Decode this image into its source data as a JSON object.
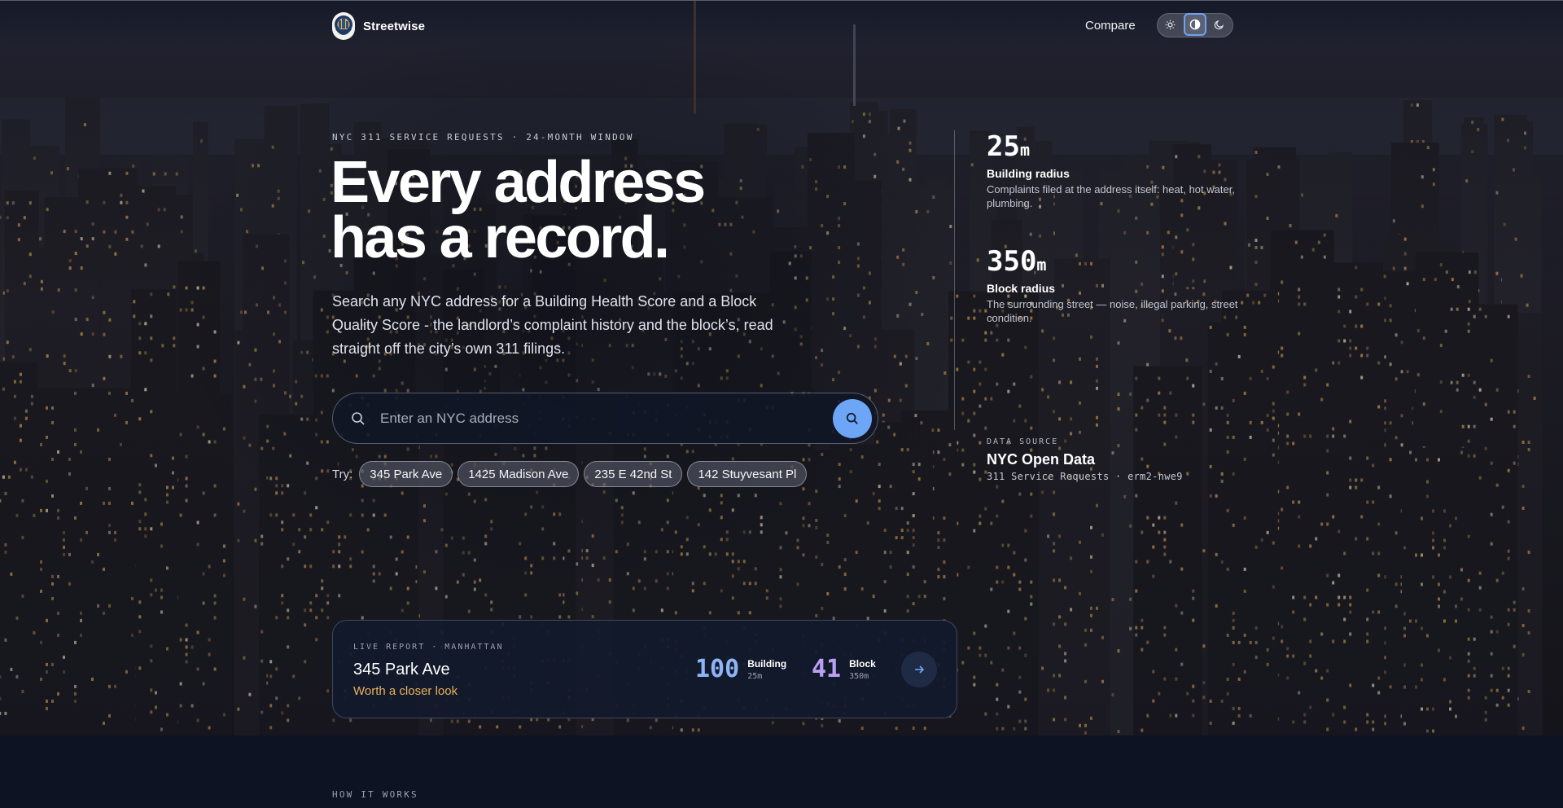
{
  "brand": {
    "name": "Streetwise",
    "logo_icon": "map-pin-globe-icon"
  },
  "nav": {
    "compare_label": "Compare",
    "theme_modes": [
      {
        "name": "light",
        "icon": "sun-icon",
        "active": false
      },
      {
        "name": "system",
        "icon": "contrast-icon",
        "active": true
      },
      {
        "name": "dark",
        "icon": "moon-icon",
        "active": false
      }
    ]
  },
  "hero": {
    "eyebrow": "NYC 311 SERVICE REQUESTS · 24-MONTH WINDOW",
    "headline_line1": "Every address",
    "headline_line2": "has a record.",
    "subtitle": "Search any NYC address for a Building Health Score and a Block Quality Score - the landlord’s complaint history and the block’s, read straight off the city’s own 311 filings.",
    "search": {
      "placeholder": "Enter an NYC address",
      "value": ""
    },
    "try_label": "Try:",
    "examples": [
      "345 Park Ave",
      "1425 Madison Ave",
      "235 E 42nd St",
      "142 Stuyvesant Pl"
    ]
  },
  "stats": {
    "building": {
      "value": "25",
      "unit": "m",
      "title": "Building radius",
      "description": "Complaints filed at the address itself: heat, hot water, plumbing."
    },
    "block": {
      "value": "350",
      "unit": "m",
      "title": "Block radius",
      "description": "The surrounding street — noise, illegal parking, street condition."
    },
    "data_source": {
      "label": "DATA SOURCE",
      "title": "NYC Open Data",
      "code": "311 Service Requests · erm2-nwe9"
    }
  },
  "report": {
    "eyebrow": "LIVE REPORT · MANHATTAN",
    "address": "345 Park Ave",
    "verdict": "Worth a closer look",
    "building_score": {
      "value": "100",
      "label": "Building",
      "radius": "25m",
      "color": "#8db4f8"
    },
    "block_score": {
      "value": "41",
      "label": "Block",
      "radius": "350m",
      "color": "#b9a0f4"
    }
  },
  "how_it_works": {
    "label": "HOW IT WORKS"
  },
  "colors": {
    "accent": "#6ea6f7",
    "verdict": "#e8b15a",
    "background": "#0d1322"
  }
}
